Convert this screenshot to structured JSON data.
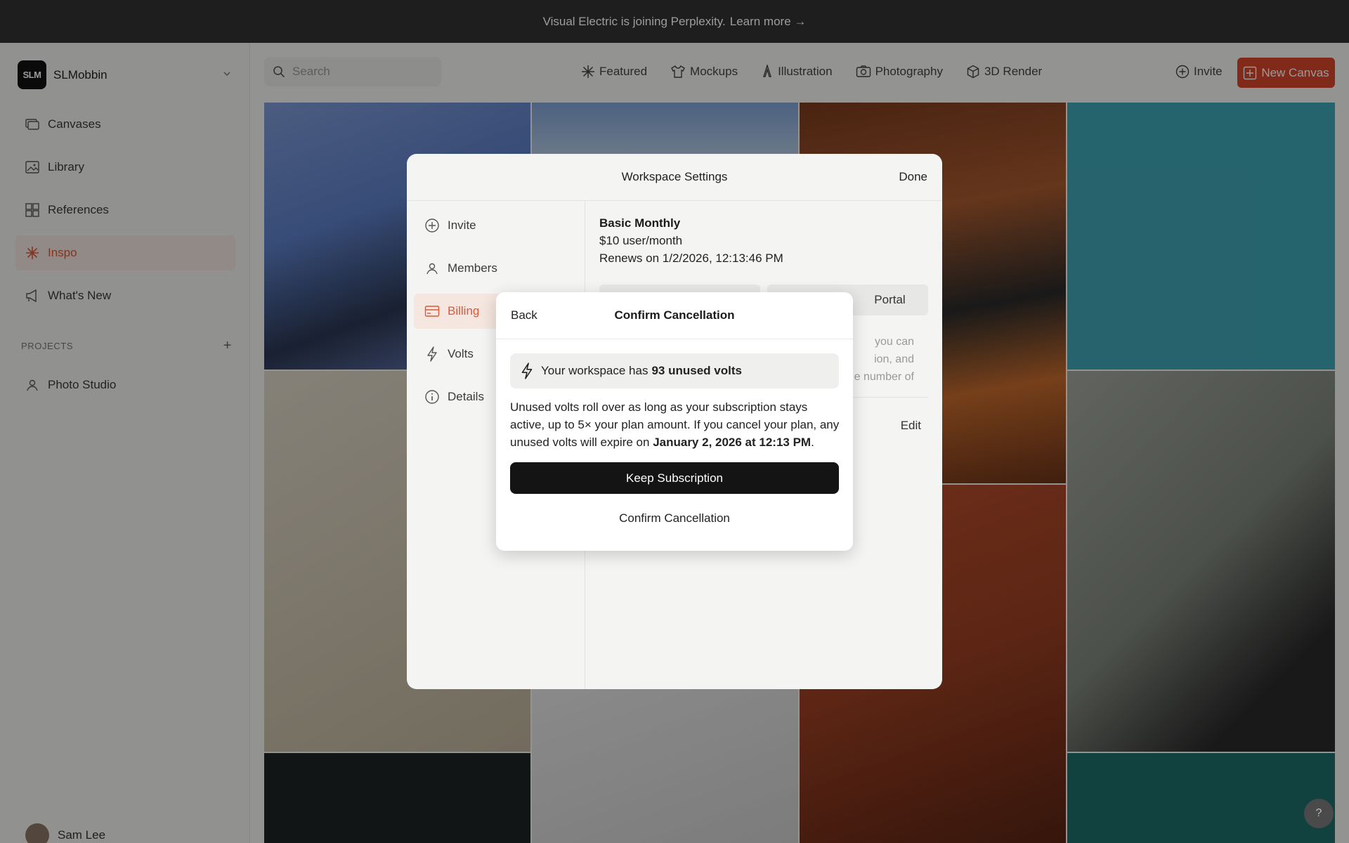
{
  "banner": {
    "text": "Visual Electric is joining Perplexity.",
    "link": "Learn more →"
  },
  "workspace": {
    "logo_text": "SLM",
    "name": "SLMobbin"
  },
  "sidebar": {
    "items": [
      {
        "label": "Canvases",
        "icon": "canvases-icon"
      },
      {
        "label": "Library",
        "icon": "library-icon"
      },
      {
        "label": "References",
        "icon": "references-icon"
      },
      {
        "label": "Inspo",
        "icon": "inspo-sparkle-icon",
        "active": true
      },
      {
        "label": "What's New",
        "icon": "megaphone-icon"
      }
    ],
    "projects_heading": "PROJECTS",
    "projects": [
      {
        "label": "Photo Studio",
        "icon": "person-icon"
      }
    ],
    "user": {
      "name": "Sam Lee"
    }
  },
  "toolbar": {
    "search_placeholder": "Search",
    "categories": [
      {
        "label": "Featured",
        "icon": "sparkle-icon"
      },
      {
        "label": "Mockups",
        "icon": "shirt-icon"
      },
      {
        "label": "Illustration",
        "icon": "pen-nib-icon"
      },
      {
        "label": "Photography",
        "icon": "camera-icon"
      },
      {
        "label": "3D Render",
        "icon": "cube-icon"
      }
    ],
    "invite_label": "Invite",
    "new_canvas_label": "New Canvas"
  },
  "settings_modal": {
    "title": "Workspace Settings",
    "done_label": "Done",
    "nav": [
      {
        "label": "Invite",
        "icon": "plus-circle-icon"
      },
      {
        "label": "Members",
        "icon": "person-icon"
      },
      {
        "label": "Billing",
        "icon": "credit-card-icon",
        "active": true
      },
      {
        "label": "Volts",
        "icon": "bolt-icon"
      },
      {
        "label": "Details",
        "icon": "info-icon"
      }
    ],
    "plan": {
      "name": "Basic Monthly",
      "price": "$10 user/month",
      "renews": "Renews on 1/2/2026, 12:13:46 PM",
      "portal_label": "Portal",
      "note_lines": [
        "you can",
        "ion, and",
        "e number of"
      ],
      "edit_label": "Edit"
    }
  },
  "confirm_dialog": {
    "back_label": "Back",
    "title": "Confirm Cancellation",
    "volts_prefix": "Your workspace has",
    "volts_bold": "93 unused volts",
    "body_text": "Unused volts roll over as long as your subscription stays active, up to 5× your plan amount. If you cancel your plan, any unused volts will expire on",
    "body_bold": "January 2, 2026 at 12:13 PM",
    "body_end": ".",
    "keep_label": "Keep Subscription",
    "confirm_label": "Confirm Cancellation"
  },
  "help_label": "?"
}
